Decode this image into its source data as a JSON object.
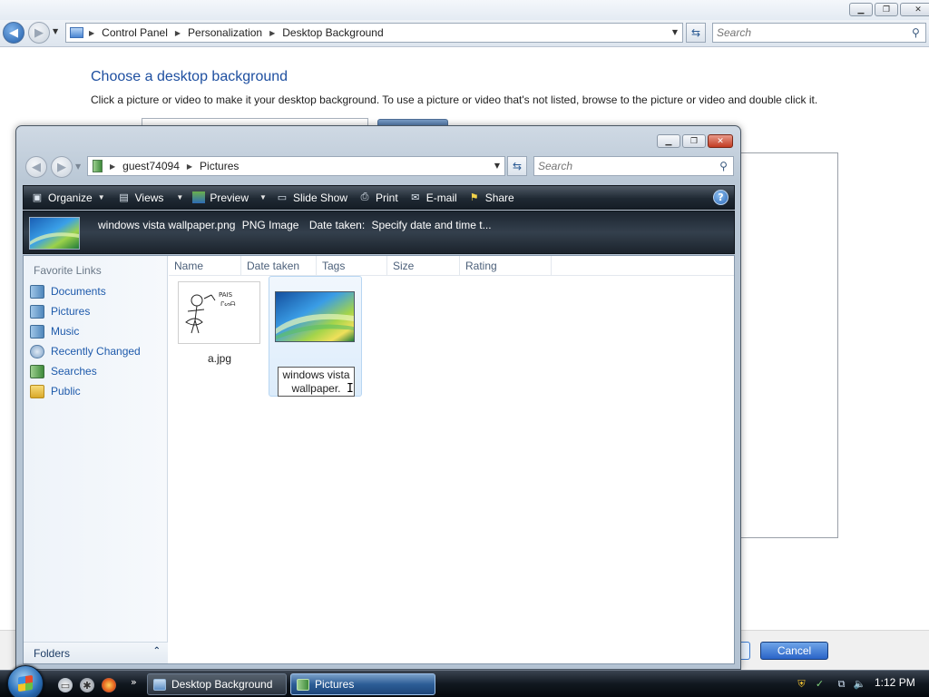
{
  "cp_window": {
    "breadcrumb": [
      "Control Panel",
      "Personalization",
      "Desktop Background"
    ],
    "search_placeholder": "Search",
    "heading": "Choose a desktop background",
    "description": "Click a picture or video to make it your desktop background. To use a picture or video that's not listed, browse to the picture or video and double click it.",
    "cancel_label": "Cancel"
  },
  "dialog": {
    "breadcrumb": [
      "guest74094",
      "Pictures"
    ],
    "search_placeholder": "Search",
    "toolbar": {
      "organize": "Organize",
      "views": "Views",
      "preview": "Preview",
      "slideshow": "Slide Show",
      "print": "Print",
      "email": "E-mail",
      "share": "Share"
    },
    "details": {
      "filename": "windows vista wallpaper.png",
      "type": "PNG Image",
      "date_label": "Date taken:",
      "date_value": "Specify date and time t..."
    },
    "favorites": {
      "heading": "Favorite Links",
      "items": [
        "Documents",
        "Pictures",
        "Music",
        "Recently Changed",
        "Searches",
        "Public"
      ]
    },
    "folders_label": "Folders",
    "columns": [
      "Name",
      "Date taken",
      "Tags",
      "Size",
      "Rating"
    ],
    "files": [
      {
        "label": "a.jpg"
      },
      {
        "label": "windows vista wallpaper."
      }
    ]
  },
  "taskbar": {
    "buttons": [
      "Desktop Background",
      "Pictures"
    ],
    "clock": "1:12 PM"
  },
  "colors": {
    "link_blue": "#1e5aab",
    "heading_blue": "#1e4fa0",
    "toolbar_dark": "#1f2933",
    "selection_blue": "#dcecfb"
  }
}
